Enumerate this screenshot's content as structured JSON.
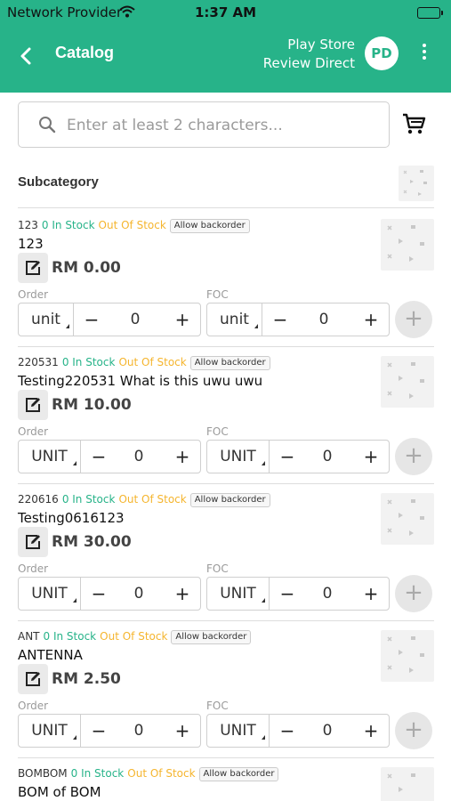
{
  "status_bar": {
    "carrier": "Network Provider",
    "time": "1:37 AM",
    "battery_level": 1.0
  },
  "header": {
    "back_icon": "chevron-left-icon",
    "title": "Catalog",
    "store_line1": "Play Store",
    "store_line2": "Review Direct",
    "avatar_initials": "PD",
    "more_icon": "more-vertical-icon"
  },
  "search": {
    "placeholder": "Enter at least 2 characters...",
    "value": "",
    "cart_icon": "cart-icon"
  },
  "subcategory": {
    "label": "Subcategory"
  },
  "labels": {
    "order": "Order",
    "foc": "FOC"
  },
  "products": [
    {
      "code": "123",
      "in_stock": "0 In Stock",
      "stock_status": "Out Of Stock",
      "backorder": "Allow backorder",
      "name": "123",
      "price": "RM 0.00",
      "order": {
        "unit": "unit",
        "qty": "0"
      },
      "foc": {
        "unit": "unit",
        "qty": "0"
      }
    },
    {
      "code": "220531",
      "in_stock": "0 In Stock",
      "stock_status": "Out Of Stock",
      "backorder": "Allow backorder",
      "name": "Testing220531 What is this uwu uwu",
      "price": "RM 10.00",
      "order": {
        "unit": "UNIT",
        "qty": "0"
      },
      "foc": {
        "unit": "UNIT",
        "qty": "0"
      }
    },
    {
      "code": "220616",
      "in_stock": "0 In Stock",
      "stock_status": "Out Of Stock",
      "backorder": "Allow backorder",
      "name": "Testing0616123",
      "price": "RM 30.00",
      "order": {
        "unit": "UNIT",
        "qty": "0"
      },
      "foc": {
        "unit": "UNIT",
        "qty": "0"
      }
    },
    {
      "code": "ANT",
      "in_stock": "0 In Stock",
      "stock_status": "Out Of Stock",
      "backorder": "Allow backorder",
      "name": "ANTENNA",
      "price": "RM 2.50",
      "order": {
        "unit": "UNIT",
        "qty": "0"
      },
      "foc": {
        "unit": "UNIT",
        "qty": "0"
      }
    },
    {
      "code": "BOMBOM",
      "in_stock": "0 In Stock",
      "stock_status": "Out Of Stock",
      "backorder": "Allow backorder",
      "name": "BOM of BOM",
      "price": "",
      "order": {
        "unit": "",
        "qty": ""
      },
      "foc": {
        "unit": "",
        "qty": ""
      }
    }
  ],
  "colors": {
    "brand": "#27b389",
    "in_stock": "#27b389",
    "out_of_stock": "#f5b52e"
  }
}
